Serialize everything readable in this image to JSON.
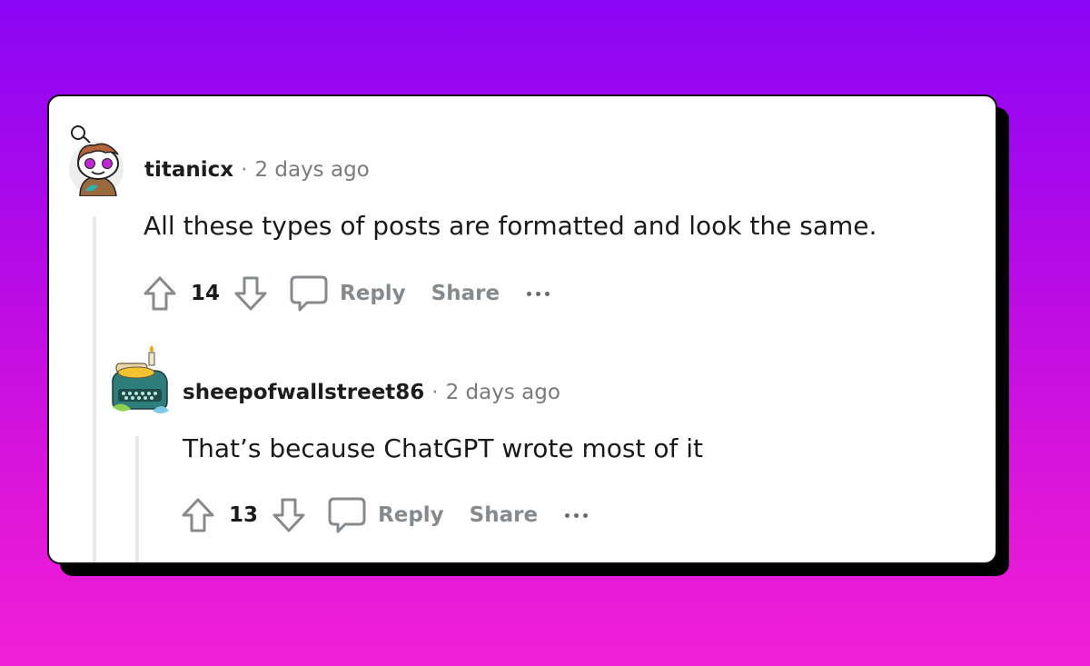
{
  "comments": [
    {
      "author": "titanicx",
      "separator": "·",
      "time": "2 days ago",
      "body": "All these types of posts are formatted and look the same.",
      "score": "14",
      "reply_label": "Reply",
      "share_label": "Share",
      "avatar_icon": "snoo-avatar-icon"
    },
    {
      "author": "sheepofwallstreet86",
      "separator": "·",
      "time": "2 days ago",
      "body": "That’s because ChatGPT wrote most of it",
      "score": "13",
      "reply_label": "Reply",
      "share_label": "Share",
      "avatar_icon": "typewriter-avatar-icon"
    }
  ],
  "colors": {
    "background_top": "#8a05f5",
    "background_bottom": "#f11fd7",
    "action_gray": "#878a8c",
    "text": "#1a1a1b"
  }
}
